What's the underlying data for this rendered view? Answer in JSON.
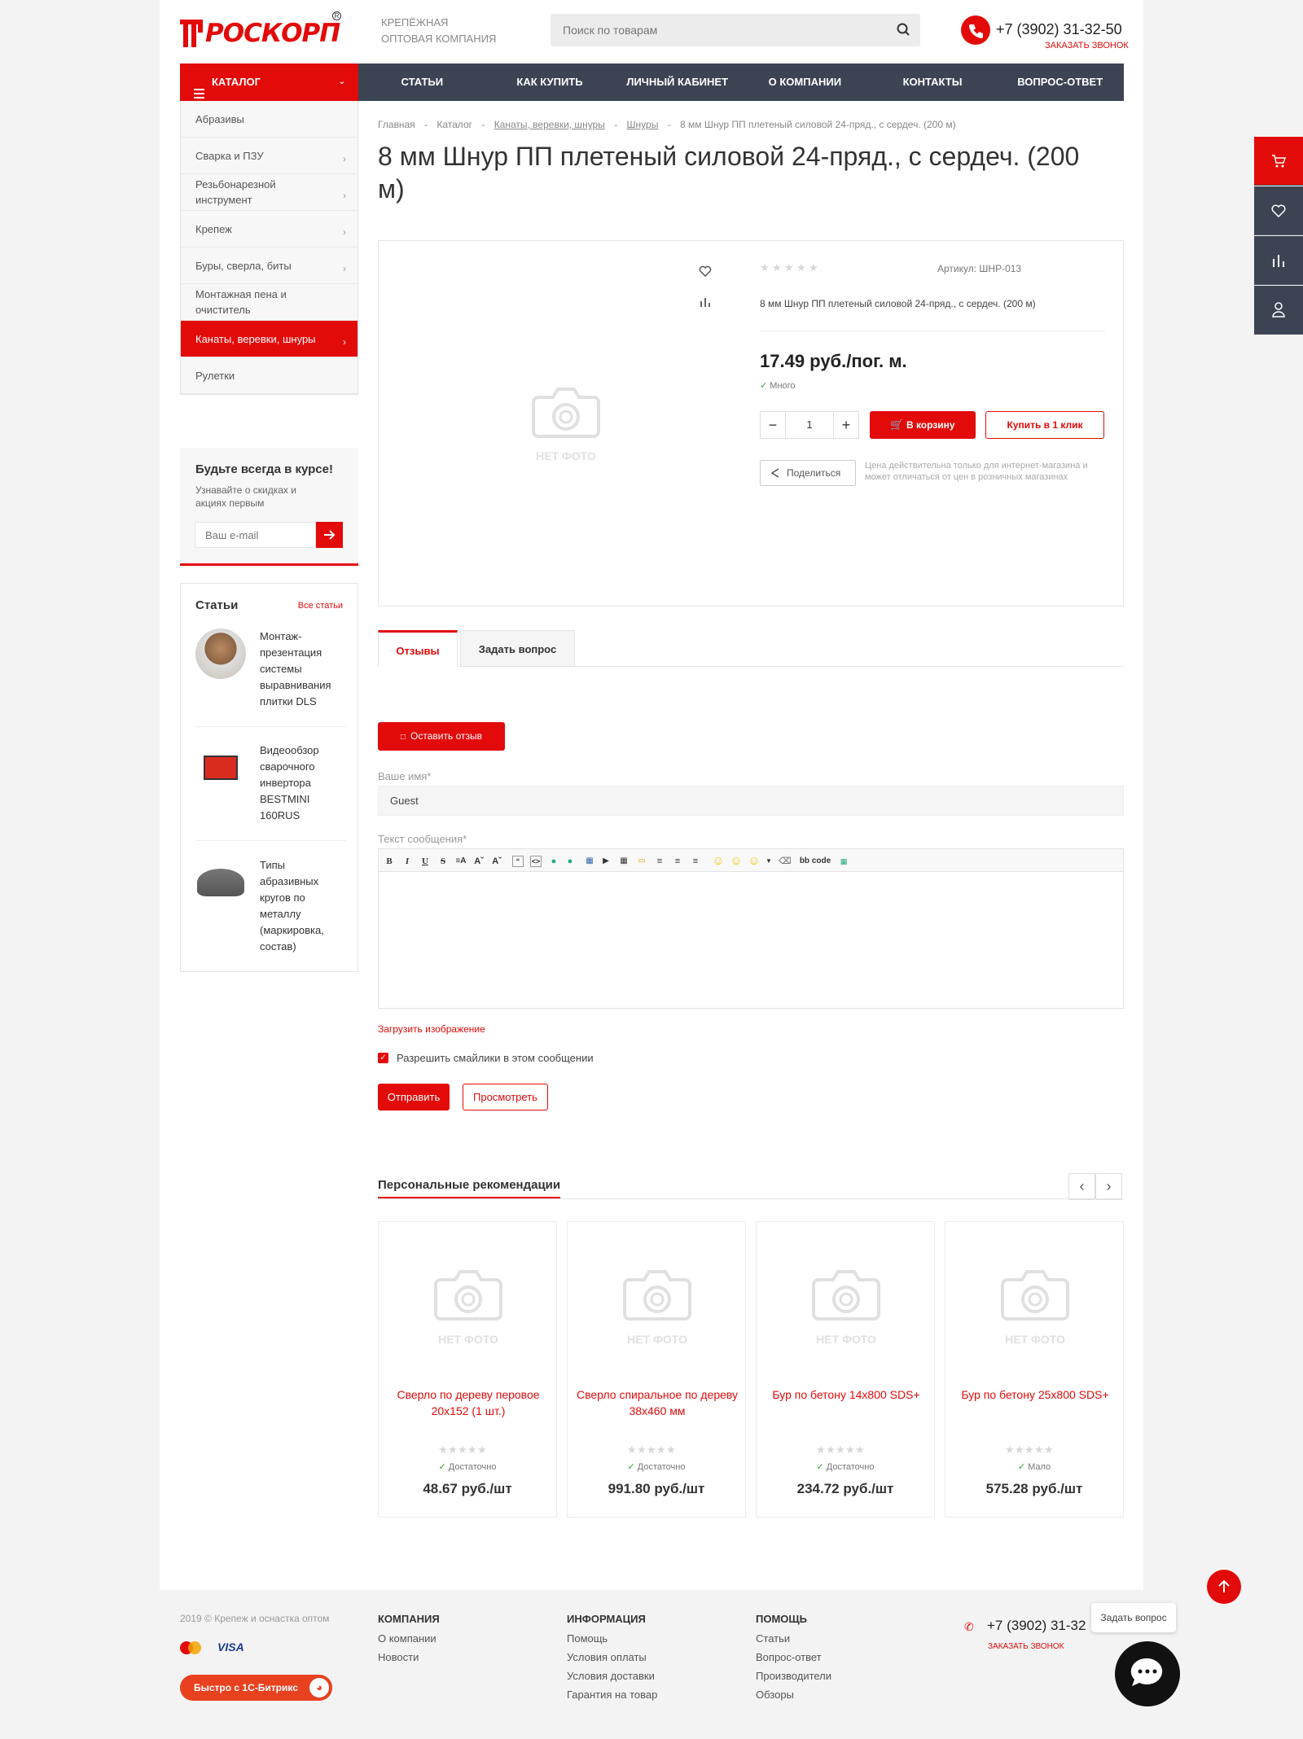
{
  "header": {
    "logo_text": "РОСКОРП",
    "tagline_1": "КРЕПЁЖНАЯ",
    "tagline_2": "ОПТОВАЯ КОМПАНИЯ",
    "search_placeholder": "Поиск по товарам",
    "phone": "+7 (3902) 31-32-50",
    "callback": "ЗАКАЗАТЬ ЗВОНОК"
  },
  "nav": {
    "catalog": "КАТАЛОГ",
    "items": [
      "СТАТЬИ",
      "КАК КУПИТЬ",
      "ЛИЧНЫЙ КАБИНЕТ",
      "О КОМПАНИИ",
      "КОНТАКТЫ",
      "ВОПРОС-ОТВЕТ"
    ]
  },
  "sidebar": {
    "items": [
      {
        "label": "Абразивы",
        "arrow": false
      },
      {
        "label": "Сварка и ПЗУ",
        "arrow": true
      },
      {
        "label": "Резьбонарезной инструмент",
        "arrow": true
      },
      {
        "label": "Крепеж",
        "arrow": true
      },
      {
        "label": "Буры, сверла, биты",
        "arrow": true
      },
      {
        "label": "Монтажная пена и очиститель",
        "arrow": false
      },
      {
        "label": "Канаты, веревки, шнуры",
        "arrow": true,
        "active": true
      },
      {
        "label": "Рулетки",
        "arrow": false
      }
    ],
    "subscribe": {
      "title": "Будьте всегда в курсе!",
      "text": "Узнавайте о скидках и акциях первым",
      "placeholder": "Ваш e-mail"
    },
    "articles": {
      "title": "Статьи",
      "all_link": "Все статьи",
      "items": [
        "Монтаж-презентация системы выравнивания плитки DLS",
        "Видеообзор сварочного инвертора BESTMINI 160RUS",
        "Типы абразивных кругов по металлу (маркировка, состав)"
      ]
    }
  },
  "breadcrumbs": [
    "Главная",
    "Каталог",
    "Канаты, веревки, шнуры",
    "Шнуры",
    "8 мм Шнур ПП плетеный силовой 24-пряд., с сердеч. (200 м)"
  ],
  "product": {
    "title": "8 мм Шнур ПП плетеный силовой 24-пряд., с сердеч. (200 м)",
    "no_photo": "НЕТ ФОТО",
    "article": "Артикул: ШНР-013",
    "short_name": "8 мм Шнур ПП плетеный силовой 24-пряд., с сердеч. (200 м)",
    "price": "17.49 руб./пог. м.",
    "stock": "Много",
    "qty": "1",
    "to_cart": "В корзину",
    "one_click": "Купить в 1 клик",
    "share": "Поделиться",
    "price_note": "Цена действительна только для интернет-магазина и может отличаться от цен в розничных магазинах"
  },
  "tabs": [
    "Отзывы",
    "Задать вопрос"
  ],
  "review_form": {
    "leave_review": "Оставить отзыв",
    "name_label": "Ваше имя*",
    "name_value": "Guest",
    "msg_label": "Текст сообщения*",
    "bbcode": "bb code",
    "upload": "Загрузить изображение",
    "smiles": "Разрешить смайлики в этом сообщении",
    "submit": "Отправить",
    "preview": "Просмотреть"
  },
  "recommendations": {
    "title": "Персональные рекомендации",
    "items": [
      {
        "name": "Сверло по дереву перовое 20х152 (1 шт.)",
        "stock": "Достаточно",
        "price": "48.67 руб./шт"
      },
      {
        "name": "Сверло спиральное по дереву 38х460 мм",
        "stock": "Достаточно",
        "price": "991.80 руб./шт"
      },
      {
        "name": "Бур по бетону 14х800 SDS+",
        "stock": "Достаточно",
        "price": "234.72 руб./шт"
      },
      {
        "name": "Бур по бетону 25х800 SDS+",
        "stock": "Мало",
        "price": "575.28 руб./шт"
      }
    ]
  },
  "footer": {
    "copyright": "2019 © Крепеж и оснастка оптом",
    "visa": "VISA",
    "bitrix": "Быстро с 1С-Битрикс",
    "col1_title": "КОМПАНИЯ",
    "col1": [
      "О компании",
      "Новости"
    ],
    "col2_title": "ИНФОРМАЦИЯ",
    "col2": [
      "Помощь",
      "Условия оплаты",
      "Условия доставки",
      "Гарантия на товар"
    ],
    "col3_title": "ПОМОЩЬ",
    "col3": [
      "Статьи",
      "Вопрос-ответ",
      "Производители",
      "Обзоры"
    ],
    "phone": "+7 (3902) 31-32",
    "callback": "ЗАКАЗАТЬ ЗВОНОК",
    "ask": "Задать вопрос"
  },
  "colors": {
    "accent": "#e30a0a",
    "nav": "#3c4454"
  }
}
